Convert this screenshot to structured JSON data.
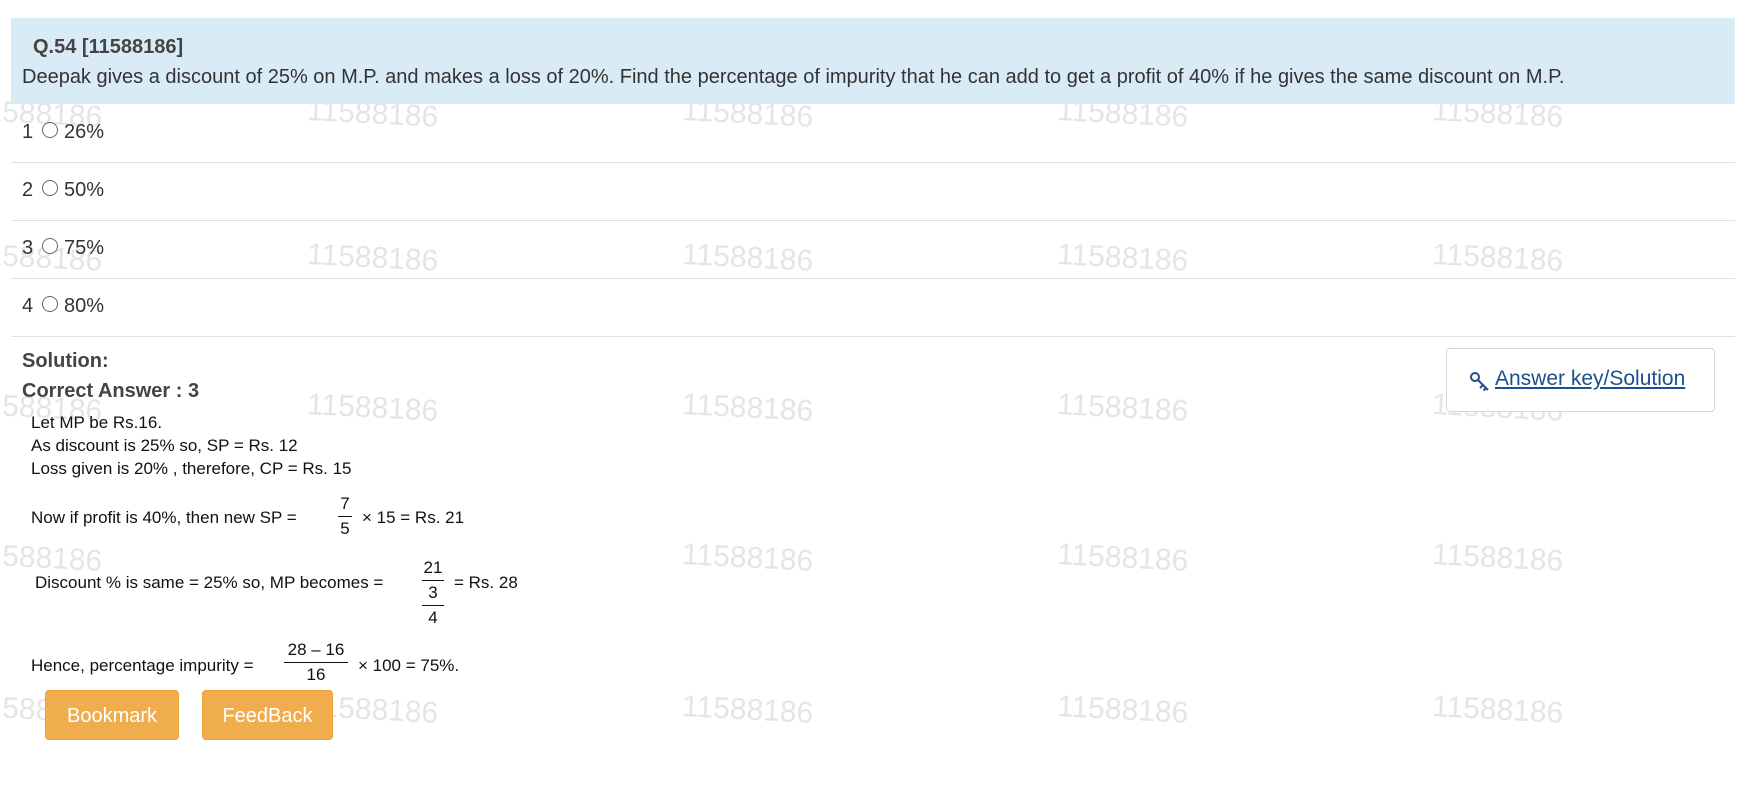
{
  "watermark": "11588186",
  "question": {
    "number": "Q.54 [11588186]",
    "text": "Deepak gives a discount of 25% on M.P. and makes a loss of 20%. Find the percentage of impurity that he can add to get a profit of 40% if he gives the same discount on M.P."
  },
  "options": [
    {
      "num": "1",
      "text": "26%"
    },
    {
      "num": "2",
      "text": "50%"
    },
    {
      "num": "3",
      "text": "75%"
    },
    {
      "num": "4",
      "text": "80%"
    }
  ],
  "solution": {
    "heading": "Solution:",
    "correct_answer": "Correct Answer : 3",
    "line1": "Let MP be Rs.16.",
    "line2": "As discount is 25% so, SP = Rs. 12",
    "line3": "Loss given is 20% , therefore, CP = Rs. 15",
    "line4_pre": "Now if profit is 40%, then new SP =",
    "line4_frac_num": "7",
    "line4_frac_den": "5",
    "line4_post": "× 15 = Rs. 21",
    "line5_pre": "Discount % is same = 25% so, MP becomes =",
    "line5_frac_num": "21",
    "line5_inner_num": "3",
    "line5_inner_den": "4",
    "line5_post": "= Rs. 28",
    "line6_pre": "Hence, percentage impurity =",
    "line6_frac_num": "28 – 16",
    "line6_frac_den": "16",
    "line6_post": "× 100 = 75%."
  },
  "answer_key": {
    "label": "Answer key/Solution",
    "icon": "key-icon",
    "color": "#1d4f8c"
  },
  "buttons": {
    "bookmark": "Bookmark",
    "feedback": "FeedBack",
    "color": "#f0ad4e"
  }
}
